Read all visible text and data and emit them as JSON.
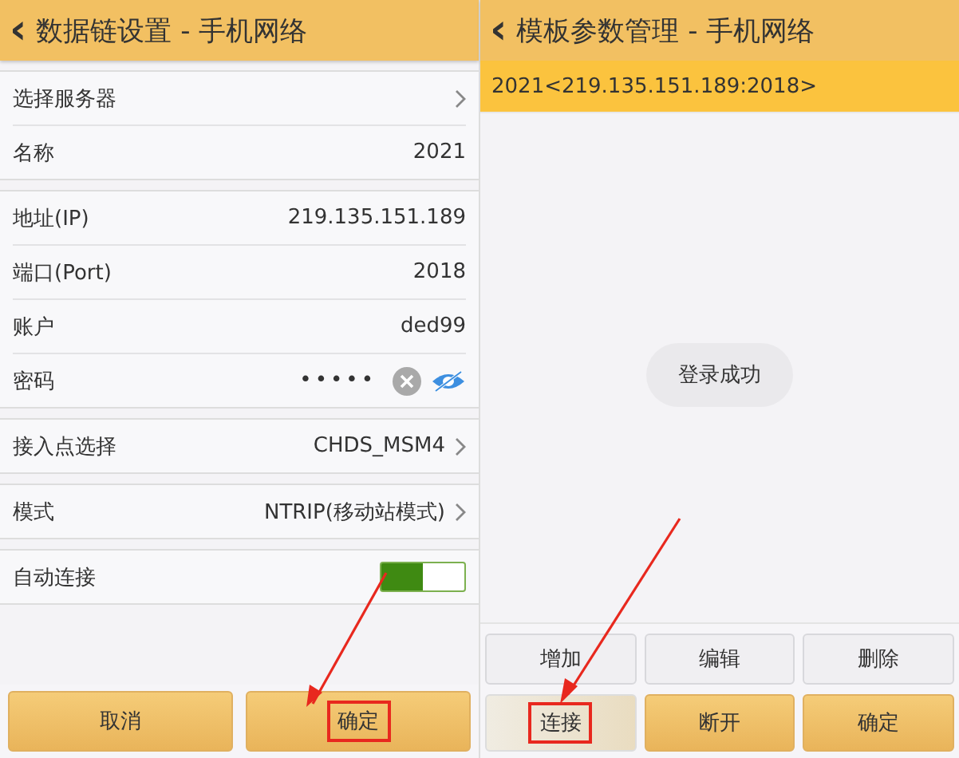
{
  "left": {
    "title": "数据链设置 - 手机网络",
    "back": "‹",
    "groups": [
      [
        {
          "kind": "link",
          "label": "选择服务器"
        },
        {
          "kind": "value",
          "label": "名称",
          "value": "2021"
        }
      ],
      [
        {
          "kind": "value",
          "label": "地址(IP)",
          "value": "219.135.151.189"
        },
        {
          "kind": "value",
          "label": "端口(Port)",
          "value": "2018"
        },
        {
          "kind": "value",
          "label": "账户",
          "value": "ded99"
        },
        {
          "kind": "password",
          "label": "密码",
          "value": "•••••"
        }
      ],
      [
        {
          "kind": "link",
          "label": "接入点选择",
          "value": "CHDS_MSM4"
        }
      ],
      [
        {
          "kind": "link",
          "label": "模式",
          "value": "NTRIP(移动站模式)"
        }
      ],
      [
        {
          "kind": "switch",
          "label": "自动连接",
          "on": true
        }
      ]
    ],
    "buttons": [
      {
        "label": "取消",
        "highlighted": false
      },
      {
        "label": "确定",
        "highlighted": true
      }
    ]
  },
  "right": {
    "title": "模板参数管理 - 手机网络",
    "back": "‹",
    "items": [
      {
        "label": "2021<219.135.151.189:2018>",
        "selected": true
      }
    ],
    "toast": "登录成功",
    "buttons": [
      {
        "label": "增加",
        "kind": "plain",
        "highlighted": false
      },
      {
        "label": "编辑",
        "kind": "plain",
        "highlighted": false
      },
      {
        "label": "删除",
        "kind": "plain",
        "highlighted": false
      },
      {
        "label": "连接",
        "kind": "fade",
        "highlighted": true
      },
      {
        "label": "断开",
        "kind": "gold",
        "highlighted": false
      },
      {
        "label": "确定",
        "kind": "gold",
        "highlighted": false
      }
    ]
  }
}
